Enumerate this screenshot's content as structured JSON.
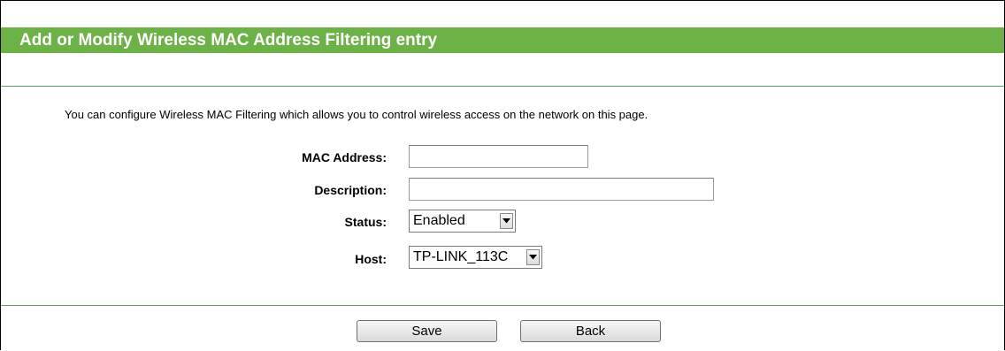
{
  "header": {
    "title": "Add or Modify Wireless MAC Address Filtering entry"
  },
  "intro_text": "You can configure Wireless MAC Filtering which allows you to control wireless access on the network on this page.",
  "form": {
    "mac_address": {
      "label": "MAC Address:",
      "value": ""
    },
    "description": {
      "label": "Description:",
      "value": ""
    },
    "status": {
      "label": "Status:",
      "selected": "Enabled"
    },
    "host": {
      "label": "Host:",
      "selected": "TP-LINK_113C"
    }
  },
  "buttons": {
    "save_label": "Save",
    "back_label": "Back"
  },
  "colors": {
    "header_bg": "#6cb246",
    "header_text": "#ffffff",
    "rule": "#5aa05a"
  },
  "icons": {
    "dropdown": "chevron-down-icon"
  }
}
